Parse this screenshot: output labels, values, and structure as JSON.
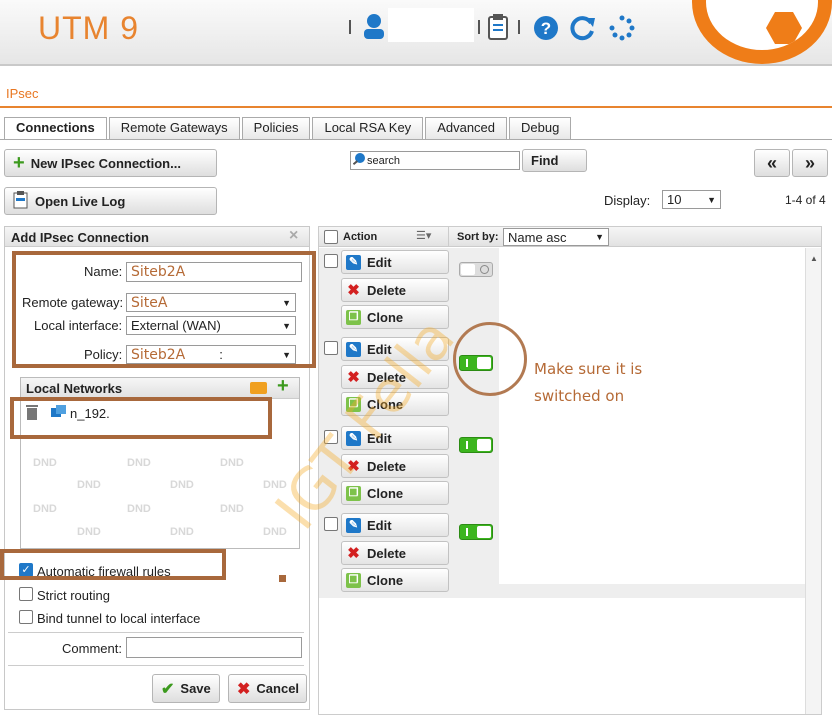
{
  "app": {
    "title": "UTM 9"
  },
  "section": "IPsec",
  "tabs": [
    "Connections",
    "Remote Gateways",
    "Policies",
    "Local RSA Key",
    "Advanced",
    "Debug"
  ],
  "toolbar": {
    "new_label": "New IPsec Connection...",
    "log_label": "Open Live Log",
    "search_placeholder": "search",
    "find_label": "Find",
    "prev": "«",
    "next": "»",
    "display_label": "Display:",
    "display_value": "10",
    "range_text": "1-4 of 4"
  },
  "form": {
    "title": "Add IPsec Connection",
    "name_label": "Name:",
    "name_value": "Siteb2A",
    "gateway_label": "Remote gateway:",
    "gateway_value": "SiteA",
    "interface_label": "Local interface:",
    "interface_value": "External (WAN)",
    "policy_label": "Policy:",
    "policy_value": "Siteb2A",
    "policy_extra": ":",
    "networks_label": "Local Networks",
    "network_item": "n_192.",
    "dnd": "DND",
    "auto_fw": "Automatic firewall rules",
    "strict": "Strict routing",
    "bind": "Bind tunnel to local interface",
    "comment_label": "Comment:",
    "save": "Save",
    "cancel": "Cancel"
  },
  "list": {
    "action_label": "Action",
    "sortby_label": "Sort by:",
    "sort_value": "Name asc",
    "edit": "Edit",
    "delete": "Delete",
    "clone": "Clone"
  },
  "rows": [
    {
      "enabled": false
    },
    {
      "enabled": true
    },
    {
      "enabled": true
    },
    {
      "enabled": true
    }
  ],
  "annotation": {
    "line1": "Make sure it is",
    "line2": "switched on",
    "watermark": "IGT Fella"
  },
  "colors": {
    "accent": "#e8842f",
    "toggle_on": "#3cb51e",
    "annotation": "#a8683c"
  }
}
